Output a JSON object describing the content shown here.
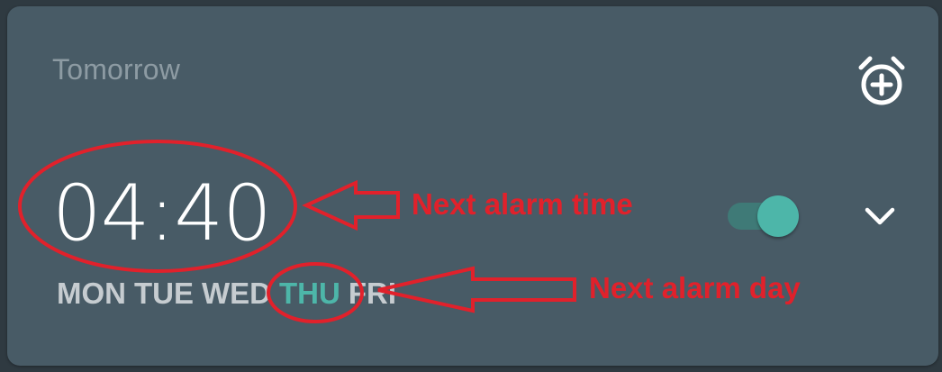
{
  "card": {
    "label": "Tomorrow"
  },
  "alarm": {
    "time": "04:40",
    "enabled": true,
    "days": [
      {
        "label": "MON",
        "active": false
      },
      {
        "label": "TUE",
        "active": false
      },
      {
        "label": "WED",
        "active": false
      },
      {
        "label": "THU",
        "active": true
      },
      {
        "label": "FRI",
        "active": false
      }
    ]
  },
  "icons": {
    "add_alarm": "add-alarm-icon",
    "expand": "chevron-down-icon"
  },
  "colors": {
    "card_background": "#485b66",
    "page_background": "#2f3a41",
    "accent": "#4db6a9",
    "annotation": "#e1212b"
  },
  "annotations": {
    "time_label": "Next alarm time",
    "day_label": "Next alarm day"
  }
}
